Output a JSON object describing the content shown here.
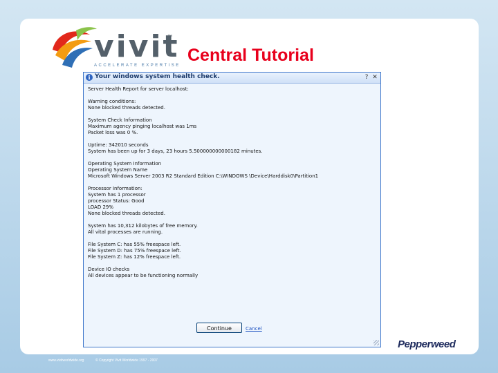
{
  "slide": {
    "title": "Central Tutorial",
    "logo": {
      "word": "vivit",
      "tm": "™",
      "tagline": "ACCELERATE EXPERTISE"
    },
    "brand_logo": "Pepperweed",
    "footer": {
      "left": "www.vivitworldwide.org",
      "right": "© Copyright Vivit Worldwide 1997 - 2007"
    }
  },
  "dialog": {
    "title": "Your windows system health check.",
    "info_icon": "i",
    "help_glyph": "?",
    "close_glyph": "✕",
    "lines": [
      "Server Health Report for server localhost:",
      "",
      "Warning conditions:",
      "None blocked threads detected.",
      "",
      "System Check Information",
      "Maximum agency pinging localhost was 1ms",
      "Packet loss was 0 %.",
      "",
      "Uptime: 342010 seconds",
      "System has been up for 3 days, 23 hours 5.500000000000182 minutes.",
      "",
      "Operating System Information",
      "Operating System Name",
      "Microsoft Windows Server 2003 R2 Standard Edition C:\\WINDOWS \\Device\\Harddisk0\\Partition1",
      "",
      "Processor Information:",
      "System has 1 processor",
      "processor Status: Good",
      "LOAD 29%",
      "None blocked threads detected.",
      "",
      "System has 10,312 kilobytes of free memory.",
      "All vital processes are running.",
      "",
      "File System C: has 55% freespace left.",
      "File System D: has 75% freespace left.",
      "File System Z: has 12% freespace left.",
      "",
      "Device IO checks",
      "All devices appear to be functioning normally"
    ],
    "continue_label": "Continue",
    "cancel_label": "Cancel"
  },
  "colors": {
    "title_red": "#e8001c",
    "vivit_gray": "#54606a",
    "dialog_border": "#3b74c9",
    "pepperweed_navy": "#1d2a5c"
  }
}
